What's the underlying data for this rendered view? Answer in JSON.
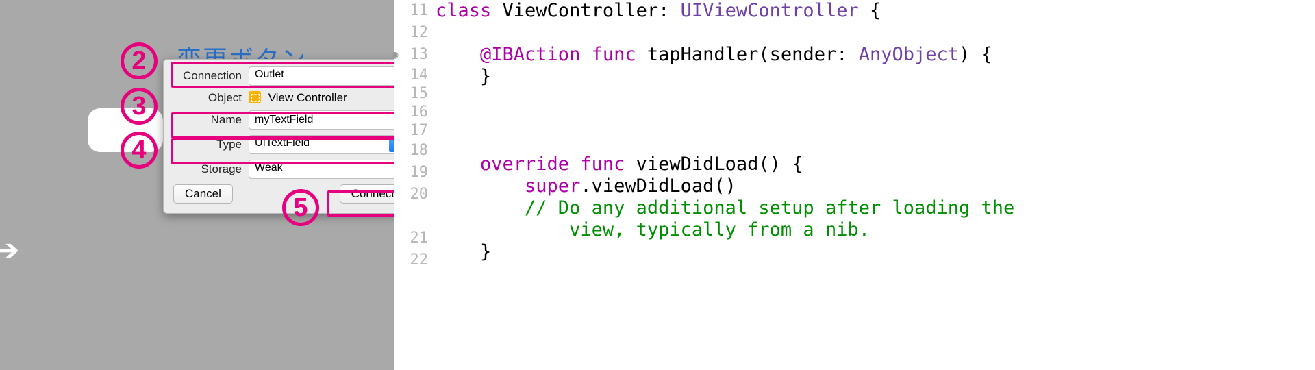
{
  "ib": {
    "partial_label": "変更ボタン"
  },
  "popover": {
    "labels": {
      "connection": "Connection",
      "object": "Object",
      "name": "Name",
      "type": "Type",
      "storage": "Storage"
    },
    "values": {
      "connection": "Outlet",
      "object": "View Controller",
      "name": "myTextField",
      "type": "UITextField",
      "storage": "Weak"
    },
    "buttons": {
      "cancel": "Cancel",
      "connect": "Connect"
    }
  },
  "annotations": {
    "n2": "2",
    "n3": "3",
    "n4": "4",
    "n5": "5"
  },
  "gutter": {
    "lines": [
      "11",
      "12",
      "13",
      "14",
      "15",
      "16",
      "17",
      "18",
      "19",
      "20",
      "21",
      "22"
    ]
  },
  "code": {
    "l11a": "class",
    "l11b": " ViewController: ",
    "l11c": "UIViewController",
    "l11d": " {",
    "l13a": "    @IBAction",
    "l13b": " func",
    "l13c": " tapHandler(sender: ",
    "l13d": "AnyObject",
    "l13e": ") {",
    "l14": "    }",
    "l18a": "    override",
    "l18b": " func",
    "l18c": " viewDidLoad() {",
    "l19a": "        super",
    "l19b": ".viewDidLoad()",
    "l20a": "        // Do any additional setup after loading the",
    "l20b": "            view, typically from a nib.",
    "l21": "    }"
  }
}
